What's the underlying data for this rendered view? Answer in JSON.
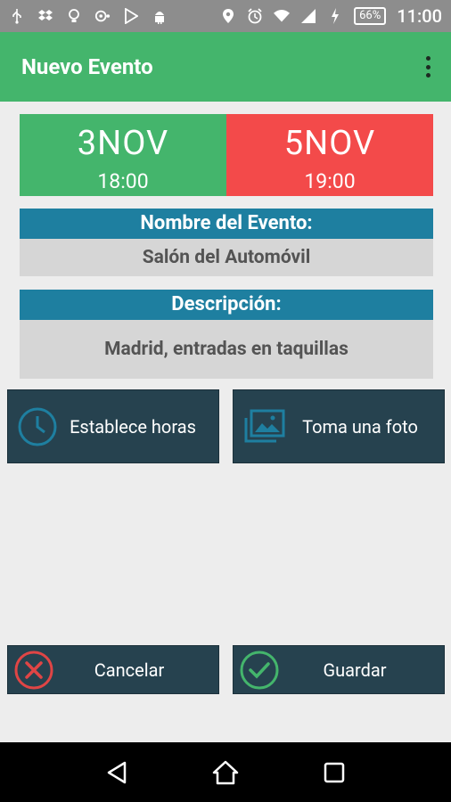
{
  "status_bar": {
    "battery": "66%",
    "time": "11:00",
    "icons": [
      "usb-icon",
      "dropbox-icon",
      "bulb-icon",
      "record-icon",
      "play-store-icon",
      "android-icon",
      "location-icon",
      "alarm-icon",
      "wifi-icon",
      "signal-icon",
      "charging-icon"
    ]
  },
  "app_bar": {
    "title": "Nuevo Evento",
    "menu_icon": "more-vert-icon",
    "color": "#44b56c"
  },
  "dates": {
    "start": {
      "day": "3NOV",
      "time": "18:00",
      "color": "#44b56c"
    },
    "end": {
      "day": "5NOV",
      "time": "19:00",
      "color": "#f34a4a"
    }
  },
  "event_name": {
    "label": "Nombre del Evento:",
    "value": "Salón del Automóvil"
  },
  "description": {
    "label": "Descripción:",
    "value": "Madrid,  entradas en taquillas"
  },
  "actions": {
    "set_hours": "Establece horas",
    "take_photo": "Toma una foto",
    "cancel": "Cancelar",
    "save": "Guardar"
  },
  "colors": {
    "section_header": "#1e7fa0",
    "button_bg": "#26424f",
    "cancel_icon": "#e04545",
    "save_icon": "#44b56c"
  }
}
